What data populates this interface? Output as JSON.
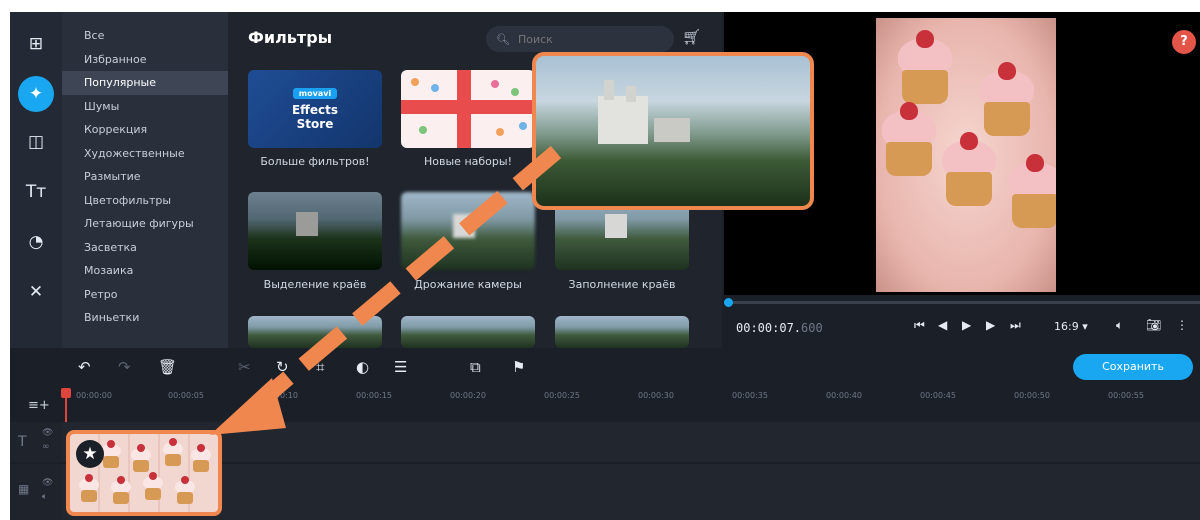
{
  "categories": [
    "Все",
    "Избранное",
    "Популярные",
    "Шумы",
    "Коррекция",
    "Художественные",
    "Размытие",
    "Цветофильтры",
    "Летающие фигуры",
    "Засветка",
    "Мозаика",
    "Ретро",
    "Виньетки"
  ],
  "selected_category": "Популярные",
  "filters": {
    "title": "Фильтры",
    "search_placeholder": "Поиск",
    "tiles": [
      {
        "label": "Больше фильтров!"
      },
      {
        "label": "Новые наборы!"
      },
      {
        "label": ""
      },
      {
        "label": "Выделение краёв"
      },
      {
        "label": "Дрожание камеры"
      },
      {
        "label": "Заполнение краёв"
      }
    ],
    "effects_store": {
      "badge": "movavi",
      "title_line1": "Effects",
      "title_line2": "Store"
    }
  },
  "player": {
    "timecode_main": "00:00:07.",
    "timecode_ms": "600",
    "aspect_ratio": "16:9 ▾",
    "help_label": "?"
  },
  "toolbar": {
    "save_label": "Сохранить"
  },
  "ruler_ticks": [
    "00:00:00",
    "00:00:05",
    "00:00:10",
    "00:00:15",
    "00:00:20",
    "00:00:25",
    "00:00:30",
    "00:00:35",
    "00:00:40",
    "00:00:45",
    "00:00:50",
    "00:00:55"
  ],
  "colors": {
    "accent": "#19a7f2",
    "highlight": "#f0874f",
    "playhead": "#e0453d"
  }
}
